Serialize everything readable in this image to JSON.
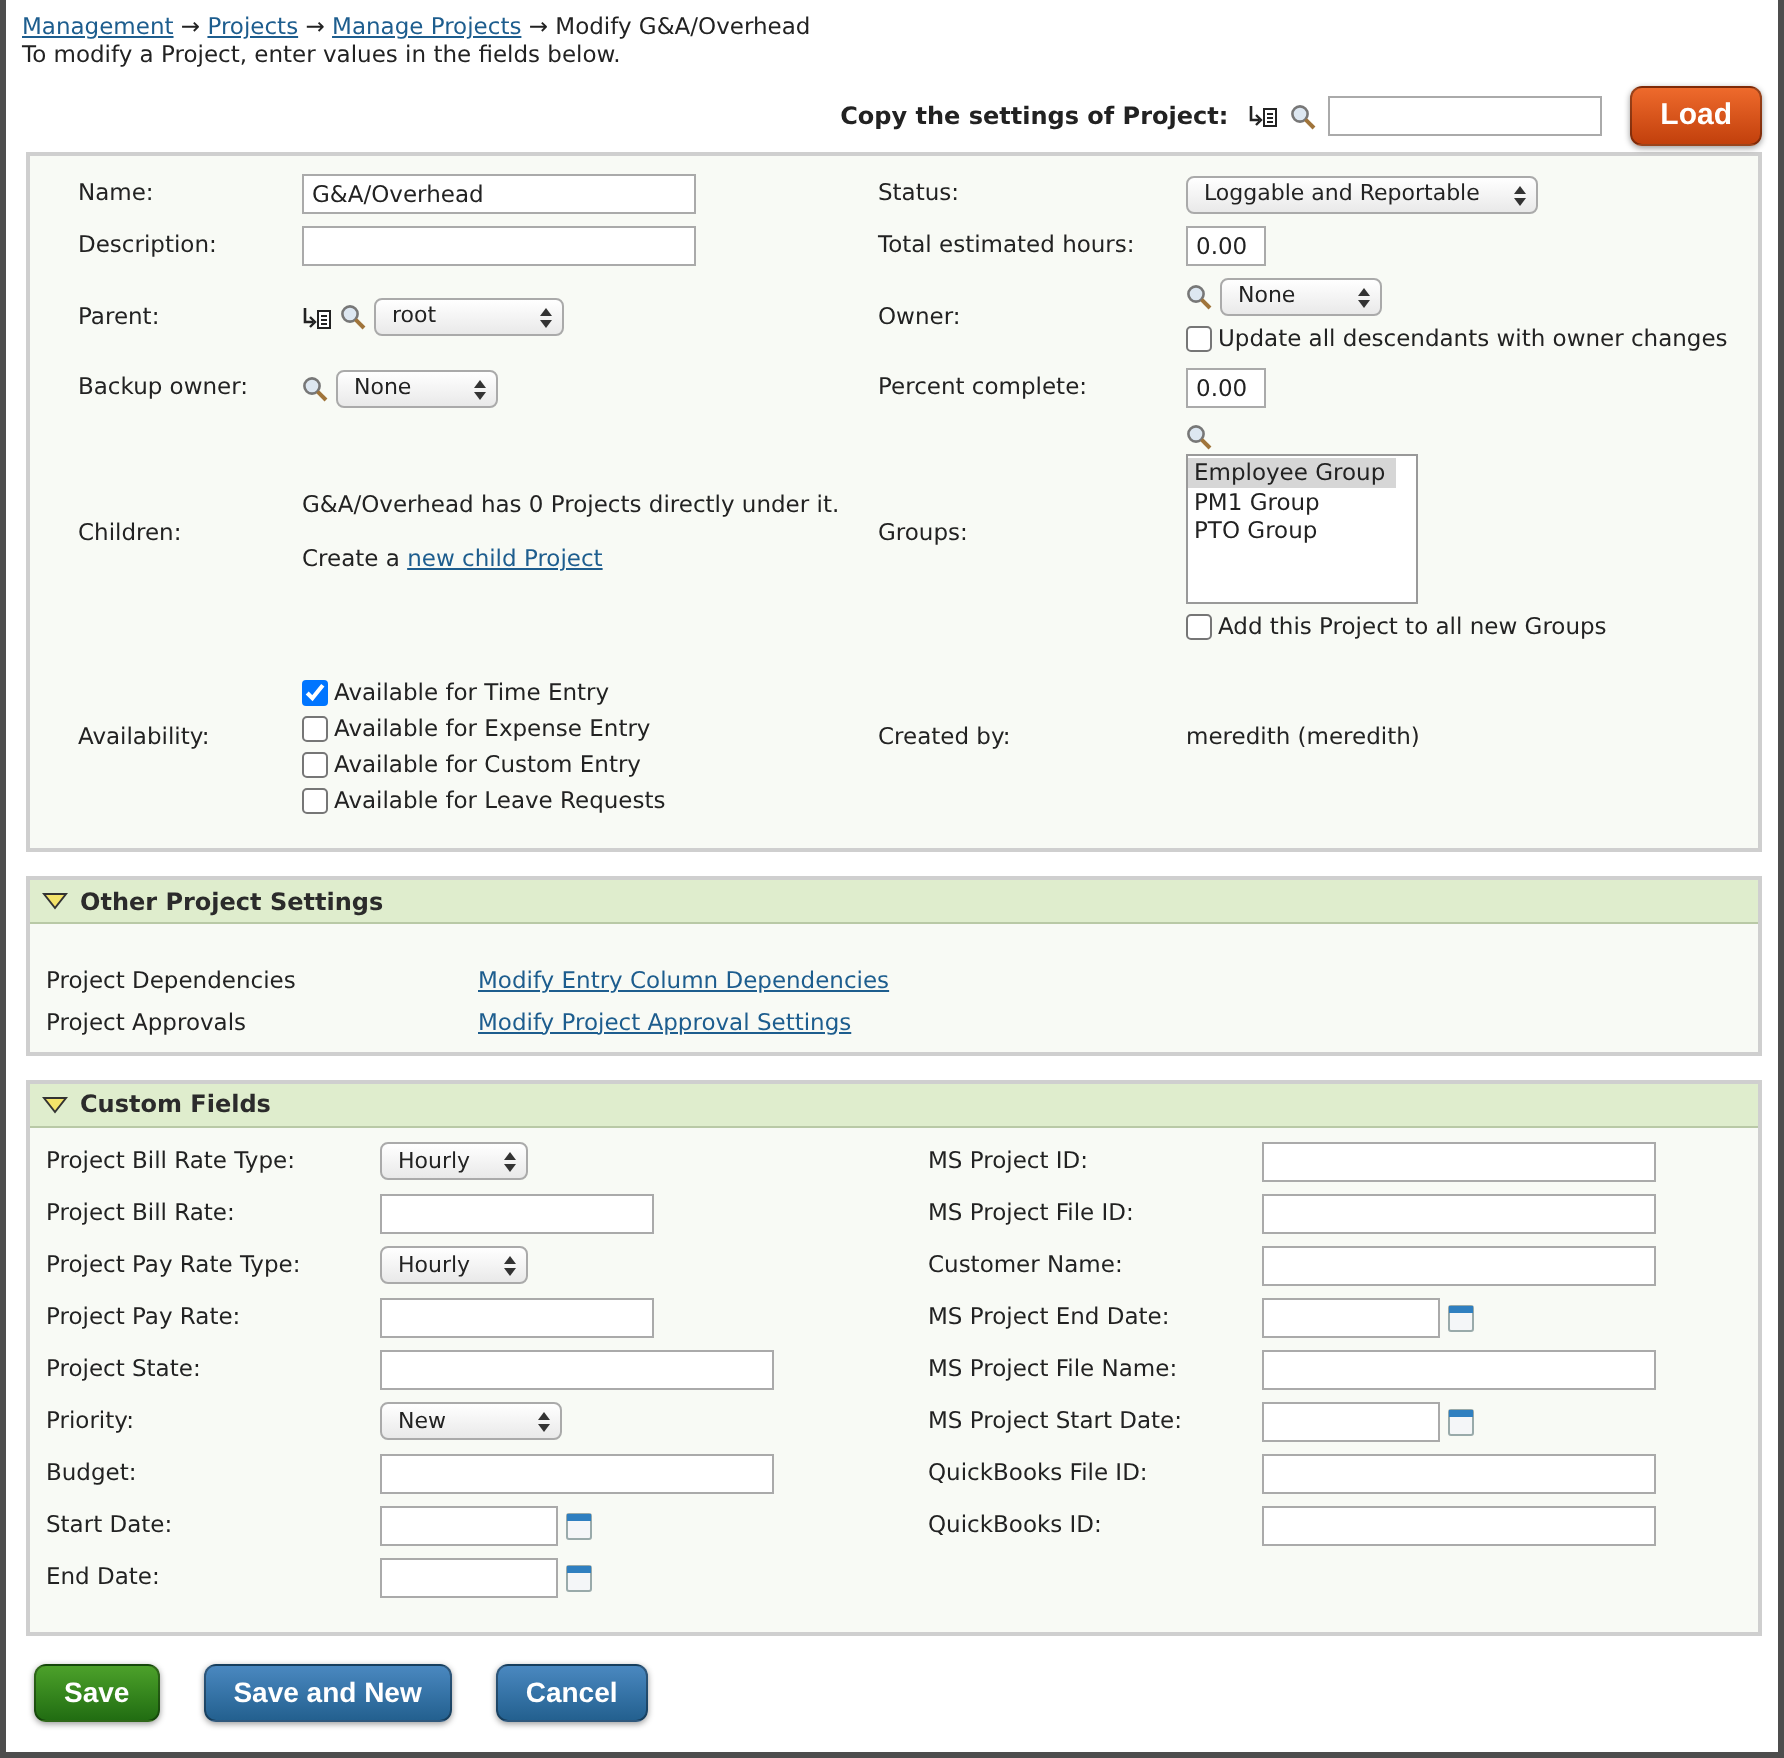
{
  "breadcrumb": [
    {
      "kind": "link",
      "label": "Management"
    },
    {
      "kind": "arrow",
      "label": "→"
    },
    {
      "kind": "link",
      "label": "Projects"
    },
    {
      "kind": "arrow",
      "label": "→"
    },
    {
      "kind": "link",
      "label": "Manage Projects"
    },
    {
      "kind": "arrow",
      "label": "→"
    },
    {
      "kind": "current",
      "label": "Modify G&A/Overhead"
    }
  ],
  "instructions": "To modify a Project, enter values in the fields below.",
  "copy_settings": {
    "label": "Copy the settings of Project:",
    "button": "Load"
  },
  "general": {
    "rows": [
      {
        "left": {
          "label": "Name:",
          "kind": "text",
          "value": "G&A/Overhead"
        },
        "right": {
          "label": "Status:",
          "kind": "select",
          "value": "Loggable and Reportable"
        }
      },
      {
        "left": {
          "label": "Description:",
          "kind": "text"
        },
        "right": {
          "label": "Total estimated hours:",
          "kind": "number",
          "value": "0.00"
        }
      },
      {
        "left": {
          "label": "Parent:",
          "kind": "tree-select",
          "value": "root"
        },
        "right": {
          "label": "Owner:",
          "kind": "owner",
          "value": "None",
          "checkbox": {
            "label": "Update all descendants with owner changes",
            "checked": false
          }
        }
      },
      {
        "left": {
          "label": "Backup owner:",
          "kind": "search-select",
          "value": "None"
        },
        "right": {
          "label": "Percent complete:",
          "kind": "number",
          "value": "0.00"
        }
      },
      {
        "left": {
          "label": "Children:",
          "kind": "children",
          "text": "G&A/Overhead has 0 Projects directly under it.",
          "prefix": "Create a",
          "link": "new child Project"
        },
        "right": {
          "label": "Groups:",
          "kind": "groups",
          "items": [
            {
              "label": "Employee Group",
              "selected": true
            },
            {
              "label": "PM1 Group",
              "selected": false
            },
            {
              "label": "PTO Group",
              "selected": false
            }
          ],
          "checkbox": {
            "label": "Add this Project to all new Groups",
            "checked": false
          }
        }
      },
      {
        "left": {
          "label": "Availability:",
          "kind": "checkboxes",
          "items": [
            {
              "label": "Available for Time Entry",
              "checked": true
            },
            {
              "label": "Available for Expense Entry",
              "checked": false
            },
            {
              "label": "Available for Custom Entry",
              "checked": false
            },
            {
              "label": "Available for Leave Requests",
              "checked": false
            }
          ]
        },
        "right": {
          "label": "Created by:",
          "kind": "plain",
          "value": "meredith (meredith)"
        }
      }
    ]
  },
  "other_settings": {
    "title": "Other Project Settings",
    "expanded": true,
    "rows": [
      {
        "label": "Project Dependencies",
        "link": "Modify Entry Column Dependencies"
      },
      {
        "label": "Project Approvals",
        "link": "Modify Project Approval Settings"
      }
    ]
  },
  "custom_fields": {
    "title": "Custom Fields",
    "expanded": true,
    "left": [
      {
        "label": "Project Bill Rate Type:",
        "kind": "select",
        "value": "Hourly"
      },
      {
        "label": "Project Bill Rate:",
        "kind": "short-text"
      },
      {
        "label": "Project Pay Rate Type:",
        "kind": "select",
        "value": "Hourly"
      },
      {
        "label": "Project Pay Rate:",
        "kind": "short-text"
      },
      {
        "label": "Project State:",
        "kind": "long-text"
      },
      {
        "label": "Priority:",
        "kind": "wide-select",
        "value": "New"
      },
      {
        "label": "Budget:",
        "kind": "long-text"
      },
      {
        "label": "Start Date:",
        "kind": "date"
      },
      {
        "label": "End Date:",
        "kind": "date"
      }
    ],
    "right": [
      {
        "label": "MS Project ID:",
        "kind": "long-text"
      },
      {
        "label": "MS Project File ID:",
        "kind": "long-text"
      },
      {
        "label": "Customer Name:",
        "kind": "long-text"
      },
      {
        "label": "MS Project End Date:",
        "kind": "date"
      },
      {
        "label": "MS Project File Name:",
        "kind": "long-text"
      },
      {
        "label": "MS Project Start Date:",
        "kind": "date"
      },
      {
        "label": "QuickBooks File ID:",
        "kind": "long-text"
      },
      {
        "label": "QuickBooks ID:",
        "kind": "long-text"
      }
    ]
  },
  "buttons": [
    {
      "label": "Save",
      "kind": "save"
    },
    {
      "label": "Save and New",
      "kind": "normal"
    },
    {
      "label": "Cancel",
      "kind": "normal"
    }
  ]
}
